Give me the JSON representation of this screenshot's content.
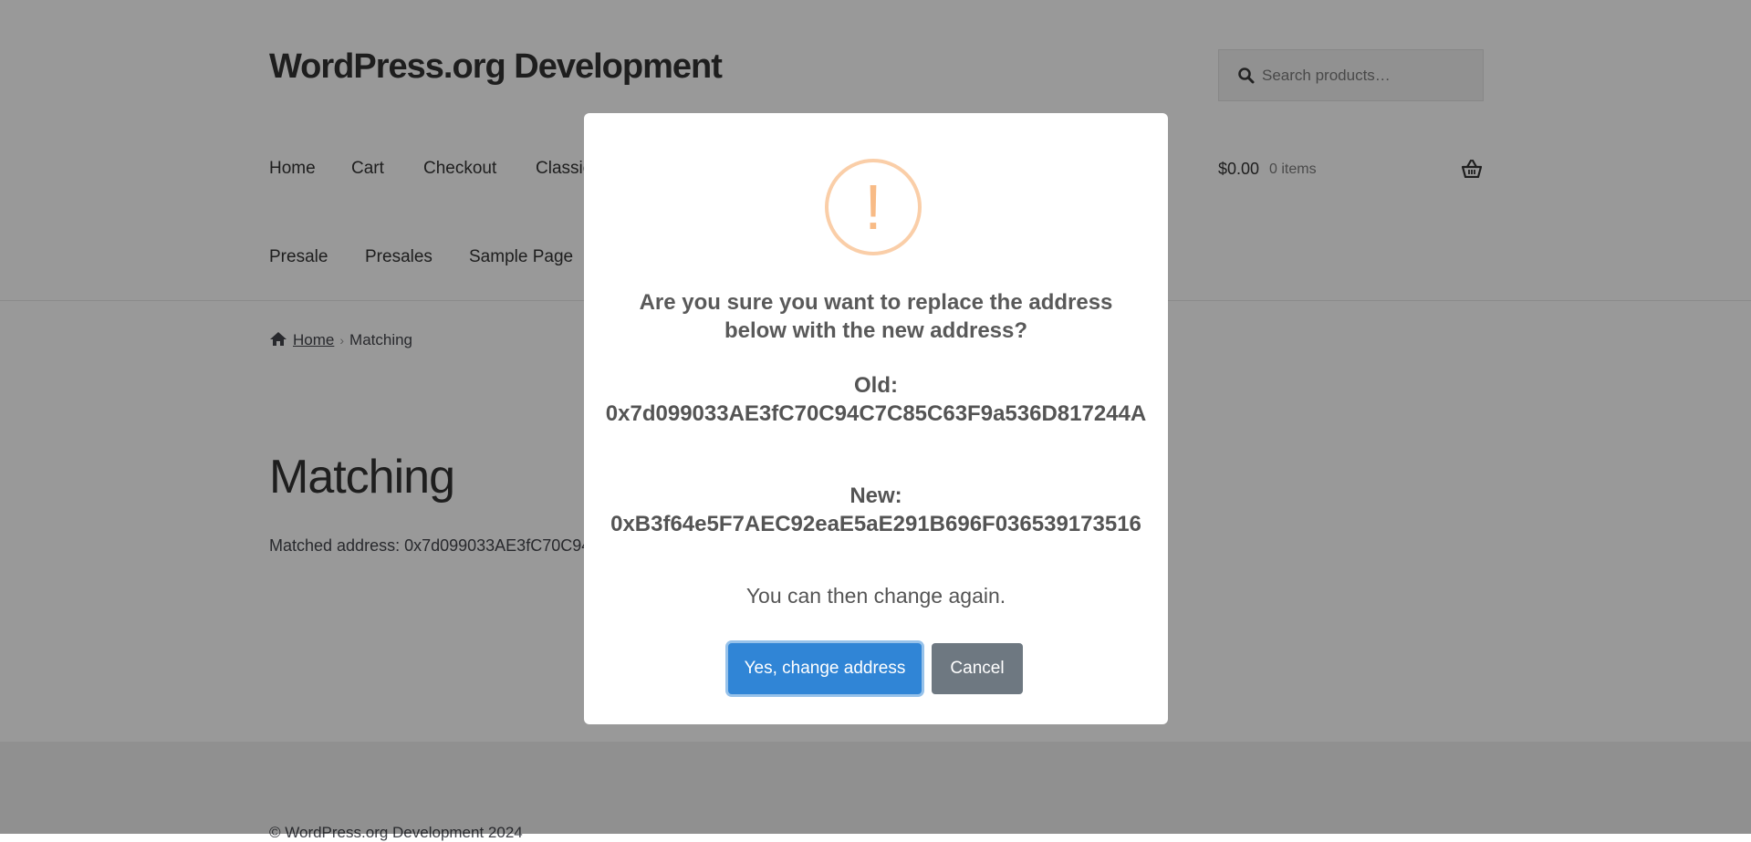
{
  "site": {
    "title": "WordPress.org Development",
    "search_placeholder": "Search products…"
  },
  "nav": {
    "row1": [
      "Home",
      "Cart",
      "Checkout",
      "Classic"
    ],
    "row2": [
      "Presale",
      "Presales",
      "Sample Page"
    ]
  },
  "cart": {
    "amount": "$0.00",
    "count": "0 items"
  },
  "breadcrumb": {
    "home": "Home",
    "current": "Matching"
  },
  "content": {
    "title": "Matching",
    "matched_text": "Matched address: 0x7d099033AE3fC70C94"
  },
  "footer": {
    "copyright": "© WordPress.org Development 2024"
  },
  "dialog": {
    "icon_glyph": "!",
    "title": "Are you sure you want to replace the address below with the new address?",
    "old_label": "Old:",
    "old_address": "0x7d099033AE3fC70C94C7C85C63F9a536D817244A",
    "new_label": "New:",
    "new_address": "0xB3f64e5F7AEC92eaE5aE291B696F036539173516",
    "note": "You can then change again.",
    "confirm_label": "Yes, change address",
    "cancel_label": "Cancel"
  },
  "colors": {
    "confirm_button": "#3085d6",
    "cancel_button": "#6e7881",
    "warning_icon": "#f8bb86"
  }
}
